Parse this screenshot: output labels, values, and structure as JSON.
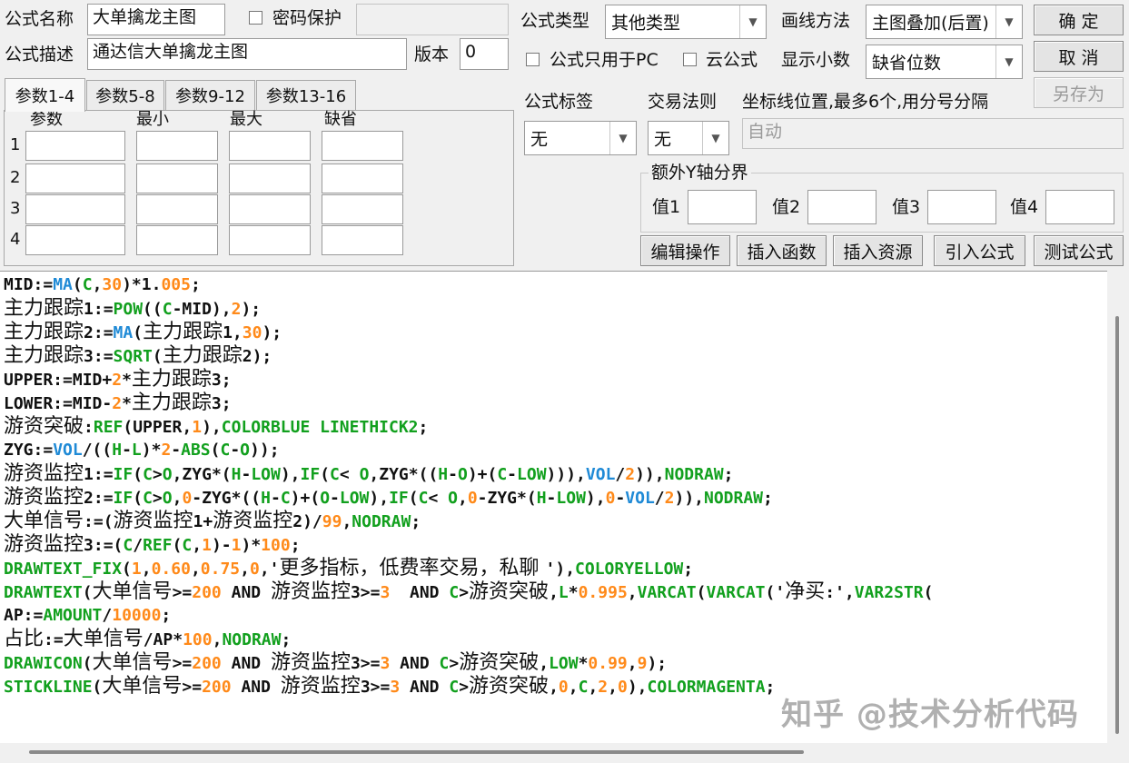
{
  "formula": {
    "name_label": "公式名称",
    "name_value": "大单擒龙主图",
    "password_label": "密码保护",
    "password_value": "",
    "desc_label": "公式描述",
    "desc_value": "通达信大单擒龙主图",
    "version_label": "版本",
    "version_value": "0"
  },
  "options": {
    "type_label": "公式类型",
    "type_value": "其他类型",
    "draw_label": "画线方法",
    "draw_value": "主图叠加(后置)",
    "pc_only_label": "公式只用于PC",
    "cloud_label": "云公式",
    "decimal_label": "显示小数",
    "decimal_value": "缺省位数",
    "tag_label": "公式标签",
    "tag_value": "无",
    "trade_label": "交易法则",
    "trade_value": "无",
    "axis_label": "坐标线位置,最多6个,用分号分隔",
    "axis_placeholder": "自动",
    "extra_y_label": "额外Y轴分界",
    "v1_label": "值1",
    "v2_label": "值2",
    "v3_label": "值3",
    "v4_label": "值4"
  },
  "buttons": {
    "ok": "确  定",
    "cancel": "取  消",
    "save_as": "另存为",
    "edit_ops": "编辑操作",
    "insert_func": "插入函数",
    "insert_res": "插入资源",
    "import_formula": "引入公式",
    "test_formula": "测试公式"
  },
  "params": {
    "tabs": [
      "参数1-4",
      "参数5-8",
      "参数9-12",
      "参数13-16"
    ],
    "headers": [
      "参数",
      "最小",
      "最大",
      "缺省"
    ],
    "rows": [
      "1",
      "2",
      "3",
      "4"
    ]
  },
  "code_lines": [
    [
      [
        "MID:=",
        ""
      ],
      [
        "MA",
        "blue"
      ],
      [
        "(",
        ""
      ],
      [
        "C",
        "green"
      ],
      [
        ",",
        ""
      ],
      [
        "30",
        "orange"
      ],
      [
        ")*1.",
        ""
      ],
      [
        "005",
        "orange"
      ],
      [
        ";",
        ""
      ]
    ],
    [
      [
        "主力跟踪",
        "cn"
      ],
      [
        "1:=",
        ""
      ],
      [
        "POW",
        "green"
      ],
      [
        "((",
        ""
      ],
      [
        "C",
        "green"
      ],
      [
        "-MID),",
        ""
      ],
      [
        "2",
        "orange"
      ],
      [
        ");",
        ""
      ]
    ],
    [
      [
        "主力跟踪",
        "cn"
      ],
      [
        "2:=",
        ""
      ],
      [
        "MA",
        "blue"
      ],
      [
        "(",
        ""
      ],
      [
        "主力跟踪",
        "cn"
      ],
      [
        "1,",
        ""
      ],
      [
        "30",
        "orange"
      ],
      [
        ");",
        ""
      ]
    ],
    [
      [
        "主力跟踪",
        "cn"
      ],
      [
        "3:=",
        ""
      ],
      [
        "SQRT",
        "green"
      ],
      [
        "(",
        ""
      ],
      [
        "主力跟踪",
        "cn"
      ],
      [
        "2);",
        ""
      ]
    ],
    [
      [
        "UPPER:=MID+",
        ""
      ],
      [
        "2",
        "orange"
      ],
      [
        "*",
        ""
      ],
      [
        "主力跟踪",
        "cn"
      ],
      [
        "3;",
        ""
      ]
    ],
    [
      [
        "LOWER:=MID-",
        ""
      ],
      [
        "2",
        "orange"
      ],
      [
        "*",
        ""
      ],
      [
        "主力跟踪",
        "cn"
      ],
      [
        "3;",
        ""
      ]
    ],
    [
      [
        "游资突破",
        "cn"
      ],
      [
        ":",
        ""
      ],
      [
        "REF",
        "green"
      ],
      [
        "(UPPER,",
        ""
      ],
      [
        "1",
        "orange"
      ],
      [
        "),",
        ""
      ],
      [
        "COLORBLUE LINETHICK2",
        "green"
      ],
      [
        ";",
        ""
      ]
    ],
    [
      [
        "ZYG:=",
        ""
      ],
      [
        "VOL",
        "blue"
      ],
      [
        "/((",
        ""
      ],
      [
        "H",
        "green"
      ],
      [
        "-",
        ""
      ],
      [
        "L",
        "green"
      ],
      [
        ")*",
        ""
      ],
      [
        "2",
        "orange"
      ],
      [
        "-",
        ""
      ],
      [
        "ABS",
        "green"
      ],
      [
        "(",
        ""
      ],
      [
        "C",
        "green"
      ],
      [
        "-",
        ""
      ],
      [
        "O",
        "green"
      ],
      [
        "));",
        ""
      ]
    ],
    [
      [
        "游资监控",
        "cn"
      ],
      [
        "1:=",
        ""
      ],
      [
        "IF",
        "green"
      ],
      [
        "(",
        ""
      ],
      [
        "C",
        "green"
      ],
      [
        ">",
        ""
      ],
      [
        "O",
        "green"
      ],
      [
        ",ZYG*(",
        ""
      ],
      [
        "H",
        "green"
      ],
      [
        "-",
        ""
      ],
      [
        "LOW",
        "green"
      ],
      [
        "),",
        ""
      ],
      [
        "IF",
        "green"
      ],
      [
        "(",
        ""
      ],
      [
        "C",
        "green"
      ],
      [
        "< ",
        ""
      ],
      [
        "O",
        "green"
      ],
      [
        ",ZYG*((",
        ""
      ],
      [
        "H",
        "green"
      ],
      [
        "-",
        ""
      ],
      [
        "O",
        "green"
      ],
      [
        ")+(",
        ""
      ],
      [
        "C",
        "green"
      ],
      [
        "-",
        ""
      ],
      [
        "LOW",
        "green"
      ],
      [
        "))),",
        ""
      ],
      [
        "VOL",
        "blue"
      ],
      [
        "/",
        ""
      ],
      [
        "2",
        "orange"
      ],
      [
        ")),",
        ""
      ],
      [
        "NODRAW",
        "green"
      ],
      [
        ";",
        ""
      ]
    ],
    [
      [
        "游资监控",
        "cn"
      ],
      [
        "2:=",
        ""
      ],
      [
        "IF",
        "green"
      ],
      [
        "(",
        ""
      ],
      [
        "C",
        "green"
      ],
      [
        ">",
        ""
      ],
      [
        "O",
        "green"
      ],
      [
        ",",
        ""
      ],
      [
        "0",
        "orange"
      ],
      [
        "-ZYG*((",
        ""
      ],
      [
        "H",
        "green"
      ],
      [
        "-",
        ""
      ],
      [
        "C",
        "green"
      ],
      [
        ")+(",
        ""
      ],
      [
        "O",
        "green"
      ],
      [
        "-",
        ""
      ],
      [
        "LOW",
        "green"
      ],
      [
        "),",
        ""
      ],
      [
        "IF",
        "green"
      ],
      [
        "(",
        ""
      ],
      [
        "C",
        "green"
      ],
      [
        "< ",
        ""
      ],
      [
        "O",
        "green"
      ],
      [
        ",",
        ""
      ],
      [
        "0",
        "orange"
      ],
      [
        "-ZYG*(",
        ""
      ],
      [
        "H",
        "green"
      ],
      [
        "-",
        ""
      ],
      [
        "LOW",
        "green"
      ],
      [
        "),",
        ""
      ],
      [
        "0",
        "orange"
      ],
      [
        "-",
        ""
      ],
      [
        "VOL",
        "blue"
      ],
      [
        "/",
        ""
      ],
      [
        "2",
        "orange"
      ],
      [
        ")),",
        ""
      ],
      [
        "NODRAW",
        "green"
      ],
      [
        ";",
        ""
      ]
    ],
    [
      [
        "大单信号",
        "cn"
      ],
      [
        ":=(",
        ""
      ],
      [
        "游资监控",
        "cn"
      ],
      [
        "1+",
        ""
      ],
      [
        "游资监控",
        "cn"
      ],
      [
        "2)/",
        ""
      ],
      [
        "99",
        "orange"
      ],
      [
        ",",
        ""
      ],
      [
        "NODRAW",
        "green"
      ],
      [
        ";",
        ""
      ]
    ],
    [
      [
        "游资监控",
        "cn"
      ],
      [
        "3:=(",
        ""
      ],
      [
        "C",
        "green"
      ],
      [
        "/",
        ""
      ],
      [
        "REF",
        "green"
      ],
      [
        "(",
        ""
      ],
      [
        "C",
        "green"
      ],
      [
        ",",
        ""
      ],
      [
        "1",
        "orange"
      ],
      [
        ")-",
        ""
      ],
      [
        "1",
        "orange"
      ],
      [
        ")*",
        ""
      ],
      [
        "100",
        "orange"
      ],
      [
        ";",
        ""
      ]
    ],
    [
      [
        "DRAWTEXT_FIX",
        "green"
      ],
      [
        "(",
        ""
      ],
      [
        "1",
        "orange"
      ],
      [
        ",",
        ""
      ],
      [
        "0.60",
        "orange"
      ],
      [
        ",",
        ""
      ],
      [
        "0.75",
        "orange"
      ],
      [
        ",",
        ""
      ],
      [
        "0",
        "orange"
      ],
      [
        ",'",
        ""
      ],
      [
        "更多指标，低费率交易，私聊 ",
        "cn"
      ],
      [
        "'),",
        ""
      ],
      [
        "COLORYELLOW",
        "green"
      ],
      [
        ";",
        ""
      ]
    ],
    [
      [
        "DRAWTEXT",
        "green"
      ],
      [
        "(",
        ""
      ],
      [
        "大单信号",
        "cn"
      ],
      [
        ">=",
        ""
      ],
      [
        "200",
        "orange"
      ],
      [
        " AND ",
        ""
      ],
      [
        "游资监控",
        "cn"
      ],
      [
        "3>=",
        ""
      ],
      [
        "3",
        "orange"
      ],
      [
        "  AND ",
        ""
      ],
      [
        "C",
        "green"
      ],
      [
        ">",
        ""
      ],
      [
        "游资突破",
        "cn"
      ],
      [
        ",",
        ""
      ],
      [
        "L",
        "green"
      ],
      [
        "*",
        ""
      ],
      [
        "0.995",
        "orange"
      ],
      [
        ",",
        ""
      ],
      [
        "VARCAT",
        "green"
      ],
      [
        "(",
        ""
      ],
      [
        "VARCAT",
        "green"
      ],
      [
        "('",
        ""
      ],
      [
        "净买",
        "cn"
      ],
      [
        ":',",
        ""
      ],
      [
        "VAR2STR",
        "green"
      ],
      [
        "(",
        ""
      ]
    ],
    [
      [
        "AP:=",
        ""
      ],
      [
        "AMOUNT",
        "green"
      ],
      [
        "/",
        ""
      ],
      [
        "10000",
        "orange"
      ],
      [
        ";",
        ""
      ]
    ],
    [
      [
        "占比",
        "cn"
      ],
      [
        ":=",
        ""
      ],
      [
        "大单信号",
        "cn"
      ],
      [
        "/AP*",
        ""
      ],
      [
        "100",
        "orange"
      ],
      [
        ",",
        ""
      ],
      [
        "NODRAW",
        "green"
      ],
      [
        ";",
        ""
      ]
    ],
    [
      [
        "DRAWICON",
        "green"
      ],
      [
        "(",
        ""
      ],
      [
        "大单信号",
        "cn"
      ],
      [
        ">=",
        ""
      ],
      [
        "200",
        "orange"
      ],
      [
        " AND ",
        ""
      ],
      [
        "游资监控",
        "cn"
      ],
      [
        "3>=",
        ""
      ],
      [
        "3",
        "orange"
      ],
      [
        " AND ",
        ""
      ],
      [
        "C",
        "green"
      ],
      [
        ">",
        ""
      ],
      [
        "游资突破",
        "cn"
      ],
      [
        ",",
        ""
      ],
      [
        "LOW",
        "green"
      ],
      [
        "*",
        ""
      ],
      [
        "0.99",
        "orange"
      ],
      [
        ",",
        ""
      ],
      [
        "9",
        "orange"
      ],
      [
        ");",
        ""
      ]
    ],
    [
      [
        "STICKLINE",
        "green"
      ],
      [
        "(",
        ""
      ],
      [
        "大单信号",
        "cn"
      ],
      [
        ">=",
        ""
      ],
      [
        "200",
        "orange"
      ],
      [
        " AND ",
        ""
      ],
      [
        "游资监控",
        "cn"
      ],
      [
        "3>=",
        ""
      ],
      [
        "3",
        "orange"
      ],
      [
        " AND ",
        ""
      ],
      [
        "C",
        "green"
      ],
      [
        ">",
        ""
      ],
      [
        "游资突破",
        "cn"
      ],
      [
        ",",
        ""
      ],
      [
        "0",
        "orange"
      ],
      [
        ",",
        ""
      ],
      [
        "C",
        "green"
      ],
      [
        ",",
        ""
      ],
      [
        "2",
        "orange"
      ],
      [
        ",",
        ""
      ],
      [
        "0",
        "orange"
      ],
      [
        "),",
        ""
      ],
      [
        "COLORMAGENTA",
        "green"
      ],
      [
        ";",
        ""
      ]
    ]
  ],
  "watermark": "知乎 @技术分析代码",
  "colors": {
    "keyword_blue": "#1f8ad6",
    "number_orange": "#ff8a1a",
    "function_green": "#12a01e"
  }
}
